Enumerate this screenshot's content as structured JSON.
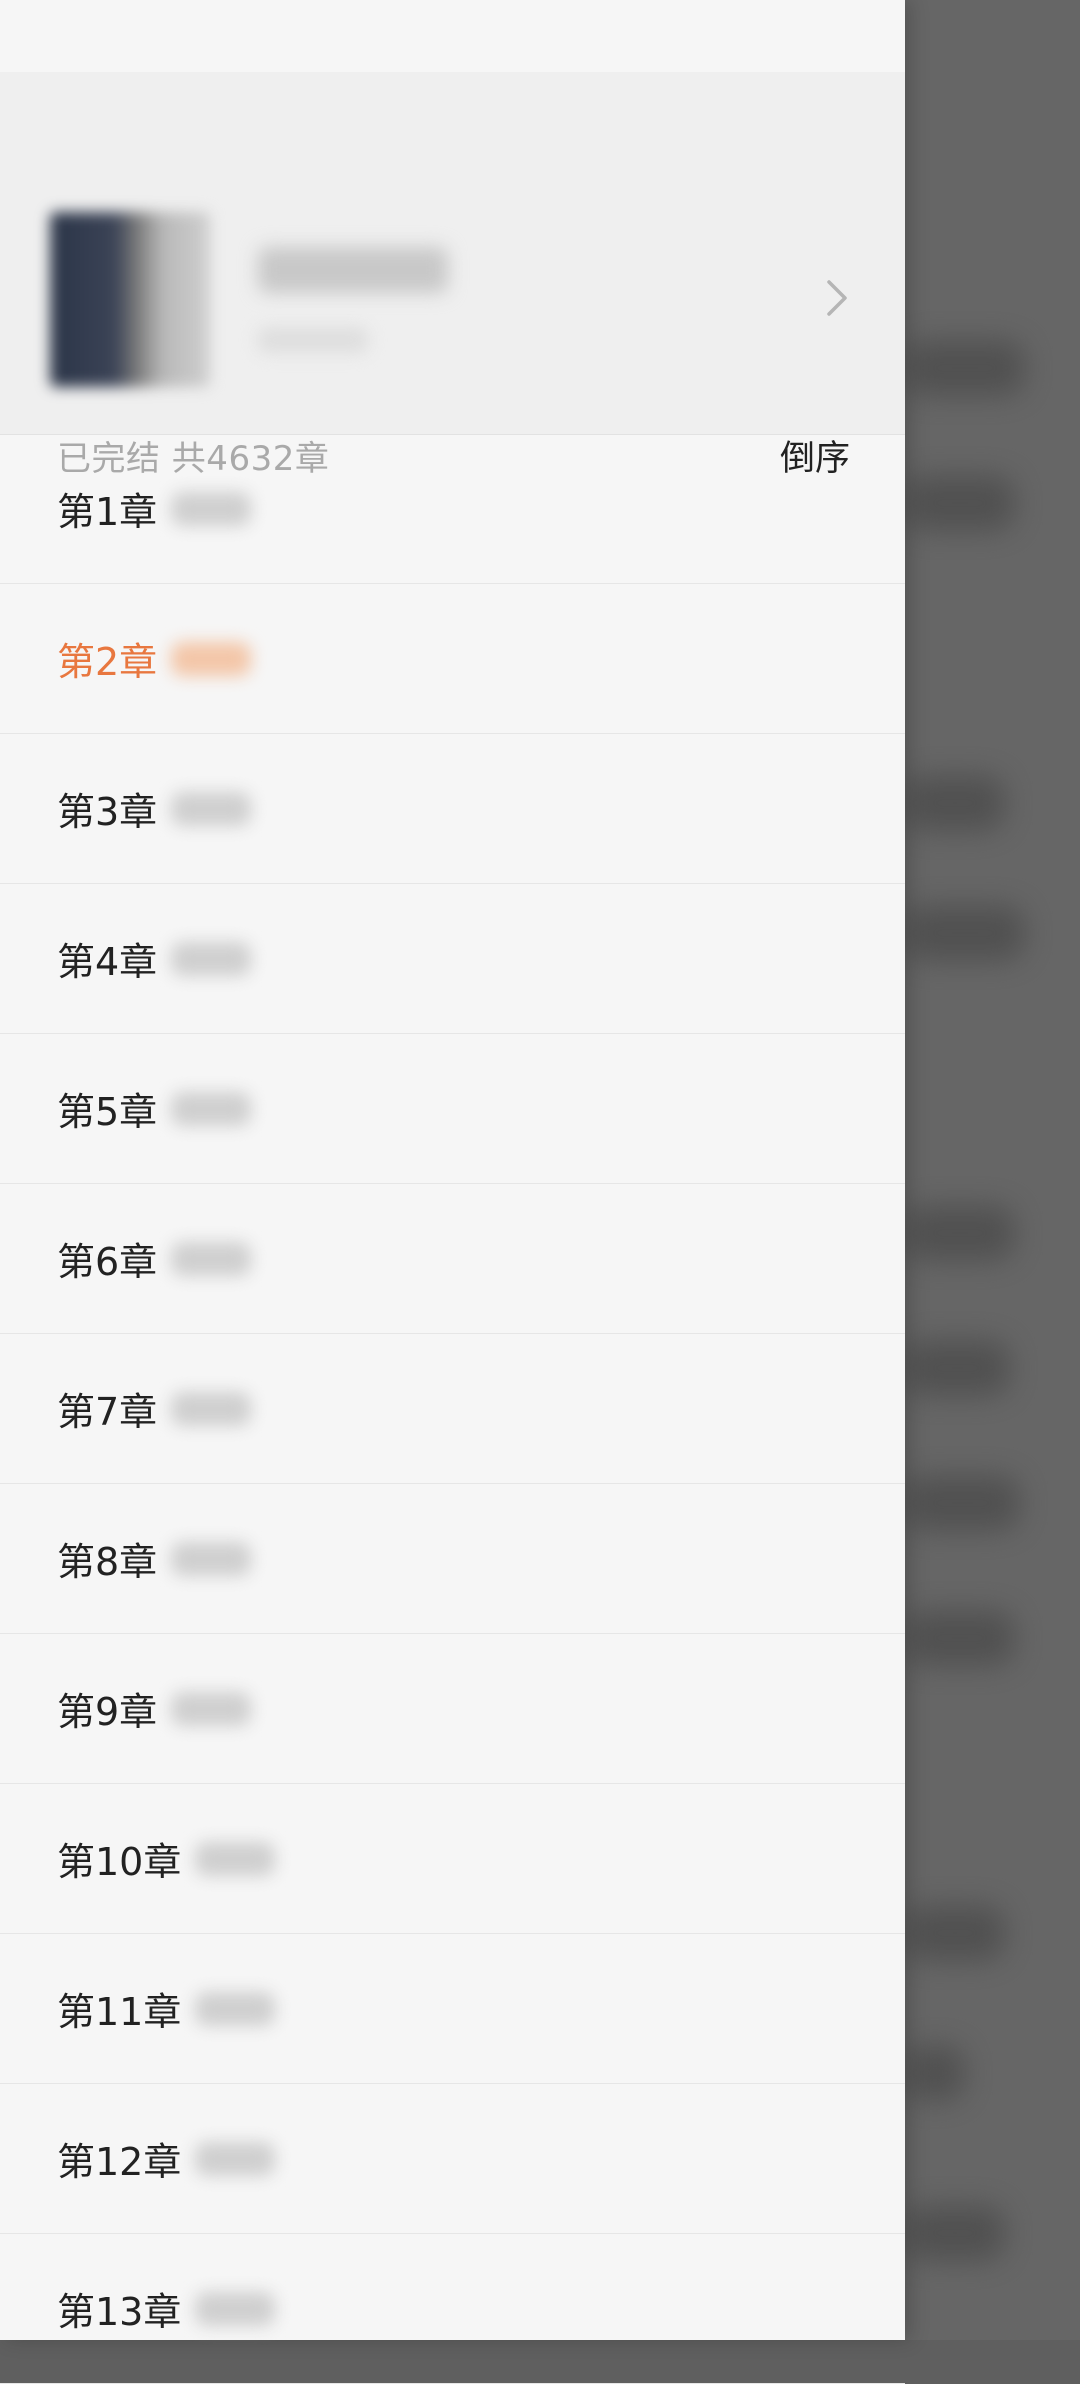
{
  "book": {
    "status_line": "已完结 共4632章",
    "sort_label": "倒序"
  },
  "icons": {
    "detail": "chevron-right-icon"
  },
  "colors": {
    "current_chapter": "#e8773f",
    "drawer_bg": "#f6f6f6",
    "overlay": "#666666"
  },
  "chapters": [
    {
      "label": "第1章",
      "current": false
    },
    {
      "label": "第2章",
      "current": true
    },
    {
      "label": "第3章",
      "current": false
    },
    {
      "label": "第4章",
      "current": false
    },
    {
      "label": "第5章",
      "current": false
    },
    {
      "label": "第6章",
      "current": false
    },
    {
      "label": "第7章",
      "current": false
    },
    {
      "label": "第8章",
      "current": false
    },
    {
      "label": "第9章",
      "current": false
    },
    {
      "label": "第10章",
      "current": false
    },
    {
      "label": "第11章",
      "current": false
    },
    {
      "label": "第12章",
      "current": false
    },
    {
      "label": "第13章",
      "current": false
    }
  ]
}
